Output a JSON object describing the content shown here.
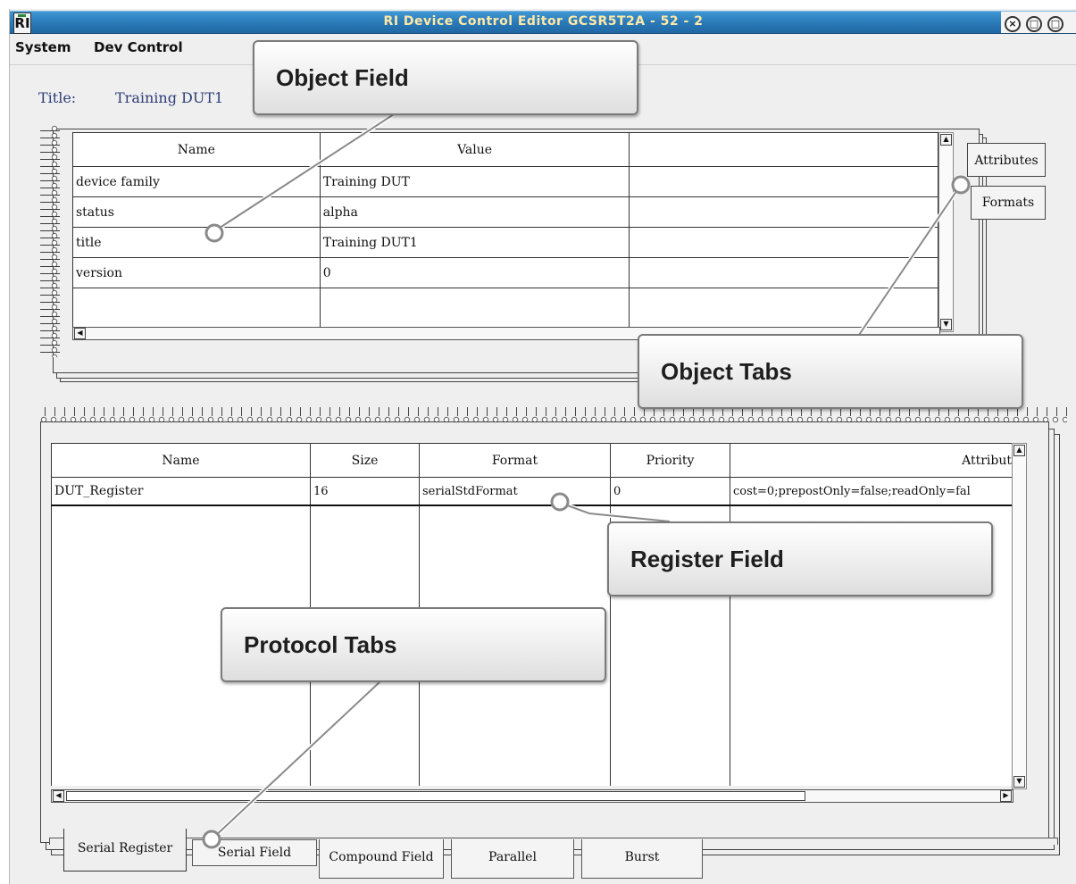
{
  "window": {
    "title": "RI Device Control Editor GCSR5T2A - 52 - 2",
    "app_icon_label": "RI",
    "buttons": {
      "close": "×",
      "minimize": "□",
      "maximize": "□"
    }
  },
  "menu": [
    "System",
    "Dev Control"
  ],
  "title_field": {
    "label": "Title:",
    "value": "Training DUT1"
  },
  "object_table": {
    "columns": [
      "Name",
      "Value",
      ""
    ],
    "rows": [
      [
        "device family",
        "Training DUT",
        ""
      ],
      [
        "status",
        "alpha",
        ""
      ],
      [
        "title",
        "Training DUT1",
        ""
      ],
      [
        "version",
        "0",
        ""
      ],
      [
        "",
        "",
        ""
      ]
    ]
  },
  "object_tabs": [
    "Attributes",
    "Formats"
  ],
  "register_table": {
    "columns": [
      "Name",
      "Size",
      "Format",
      "Priority",
      "Attribut"
    ],
    "rows": [
      [
        "DUT_Register",
        "16",
        "serialStdFormat",
        "0",
        "cost=0;prepostOnly=false;readOnly=fal"
      ]
    ]
  },
  "protocol_tabs": [
    "Serial Register",
    "Serial Field",
    "Compound Field",
    "Parallel",
    "Burst"
  ],
  "callouts": {
    "object_field": "Object Field",
    "object_tabs": "Object Tabs",
    "register_field": "Register Field",
    "protocol_tabs": "Protocol Tabs"
  },
  "colors": {
    "titlebar": "#2a7ab8",
    "title_text": "#ffe9a8",
    "title_label": "#2e3e78",
    "callout_border": "#7a7a7a"
  }
}
